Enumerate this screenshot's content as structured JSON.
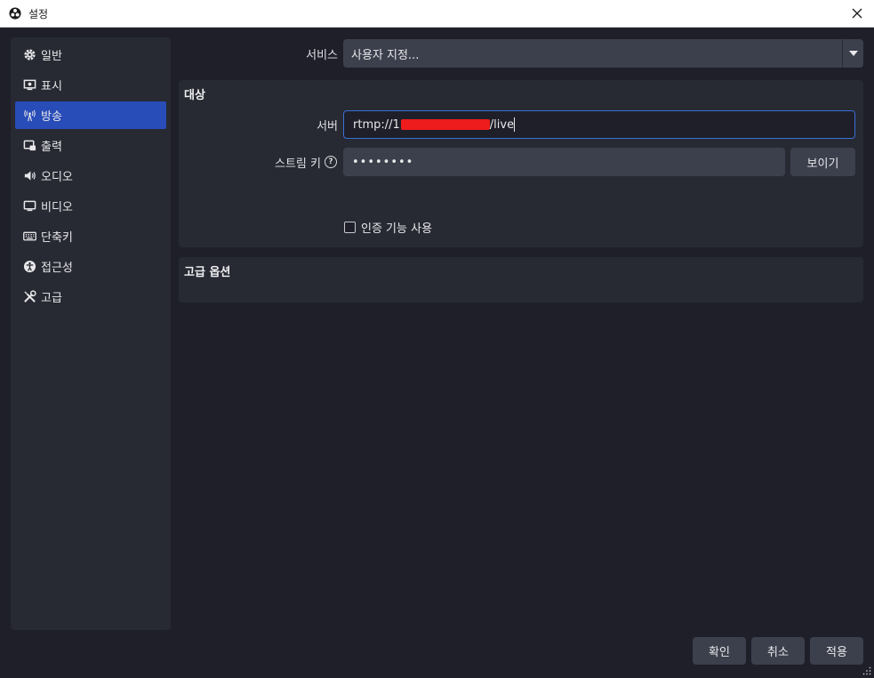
{
  "window": {
    "title": "설정"
  },
  "sidebar": {
    "items": [
      {
        "label": "일반",
        "icon": "gear-icon"
      },
      {
        "label": "표시",
        "icon": "display-icon"
      },
      {
        "label": "방송",
        "icon": "antenna-icon",
        "active": true
      },
      {
        "label": "출력",
        "icon": "output-icon"
      },
      {
        "label": "오디오",
        "icon": "speaker-icon"
      },
      {
        "label": "비디오",
        "icon": "monitor-icon"
      },
      {
        "label": "단축키",
        "icon": "keyboard-icon"
      },
      {
        "label": "접근성",
        "icon": "accessibility-icon"
      },
      {
        "label": "고급",
        "icon": "tools-icon"
      }
    ]
  },
  "service": {
    "label": "서비스",
    "value": "사용자 지정..."
  },
  "destination": {
    "title": "대상",
    "server_label": "서버",
    "server_prefix": "rtmp://1",
    "server_suffix": "/live",
    "key_label": "스트림 키",
    "key_value": "••••••••",
    "show_button": "보이기",
    "auth_checkbox": "인증 기능 사용",
    "auth_checked": false
  },
  "advanced": {
    "title": "고급 옵션"
  },
  "footer": {
    "ok": "확인",
    "cancel": "취소",
    "apply": "적용"
  },
  "colors": {
    "accent": "#284cb8",
    "redaction": "#ee1c1c",
    "background": "#1e1f29",
    "panel": "#272a33"
  }
}
